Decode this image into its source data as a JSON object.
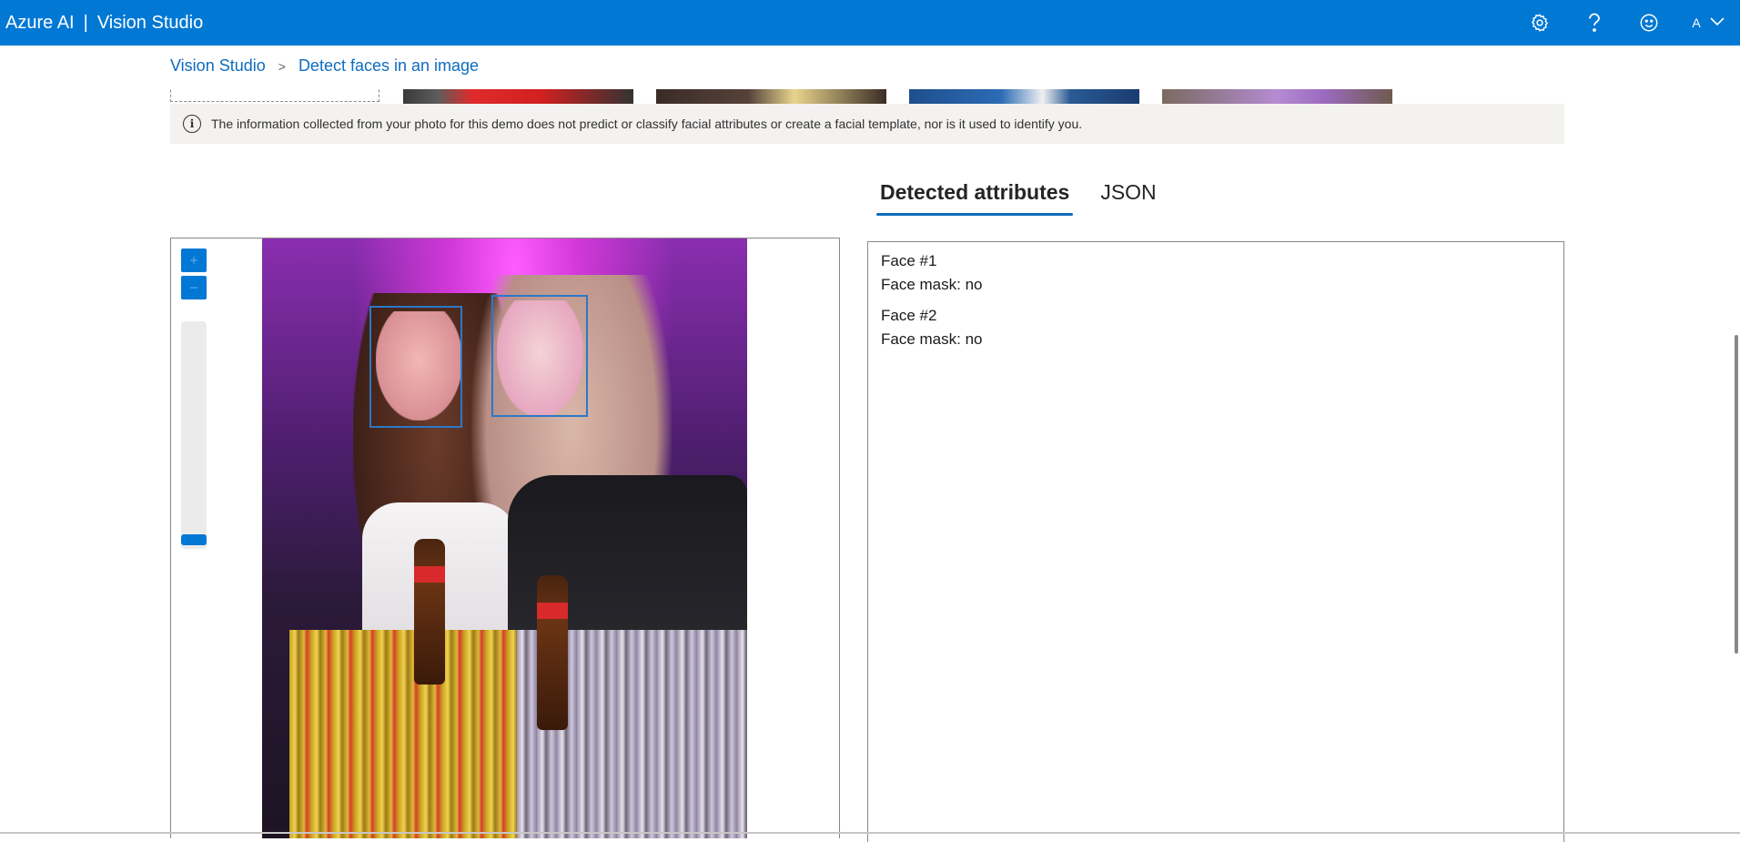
{
  "header": {
    "brand": "Azure AI",
    "separator": "|",
    "app_name": "Vision Studio",
    "avatar_initial": "A",
    "icons": [
      "gear-icon",
      "help-icon",
      "smiley-icon",
      "chevron-down-icon"
    ]
  },
  "breadcrumb": {
    "items": [
      {
        "label": "Vision Studio"
      },
      {
        "label": "Detect faces in an image"
      }
    ],
    "separator": ">"
  },
  "info_banner": {
    "icon": "info-icon",
    "text": "The information collected from your photo for this demo does not predict or classify facial attributes or create a facial template, nor is it used to identify you."
  },
  "tabs": [
    {
      "label": "Detected attributes",
      "active": true
    },
    {
      "label": "JSON",
      "active": false
    }
  ],
  "viewer": {
    "zoom_in_icon": "plus-icon",
    "zoom_out_icon": "minus-icon",
    "zoom_level": 0.0,
    "detected_faces": 2
  },
  "results": {
    "faces": [
      {
        "title": "Face #1",
        "mask": "Face mask: no"
      },
      {
        "title": "Face #2",
        "mask": "Face mask: no"
      }
    ]
  },
  "colors": {
    "header_bg": "#0078d4",
    "accent": "#0f6cbd",
    "banner_bg": "#f3f2f1",
    "face_box": "#2b78c8"
  }
}
